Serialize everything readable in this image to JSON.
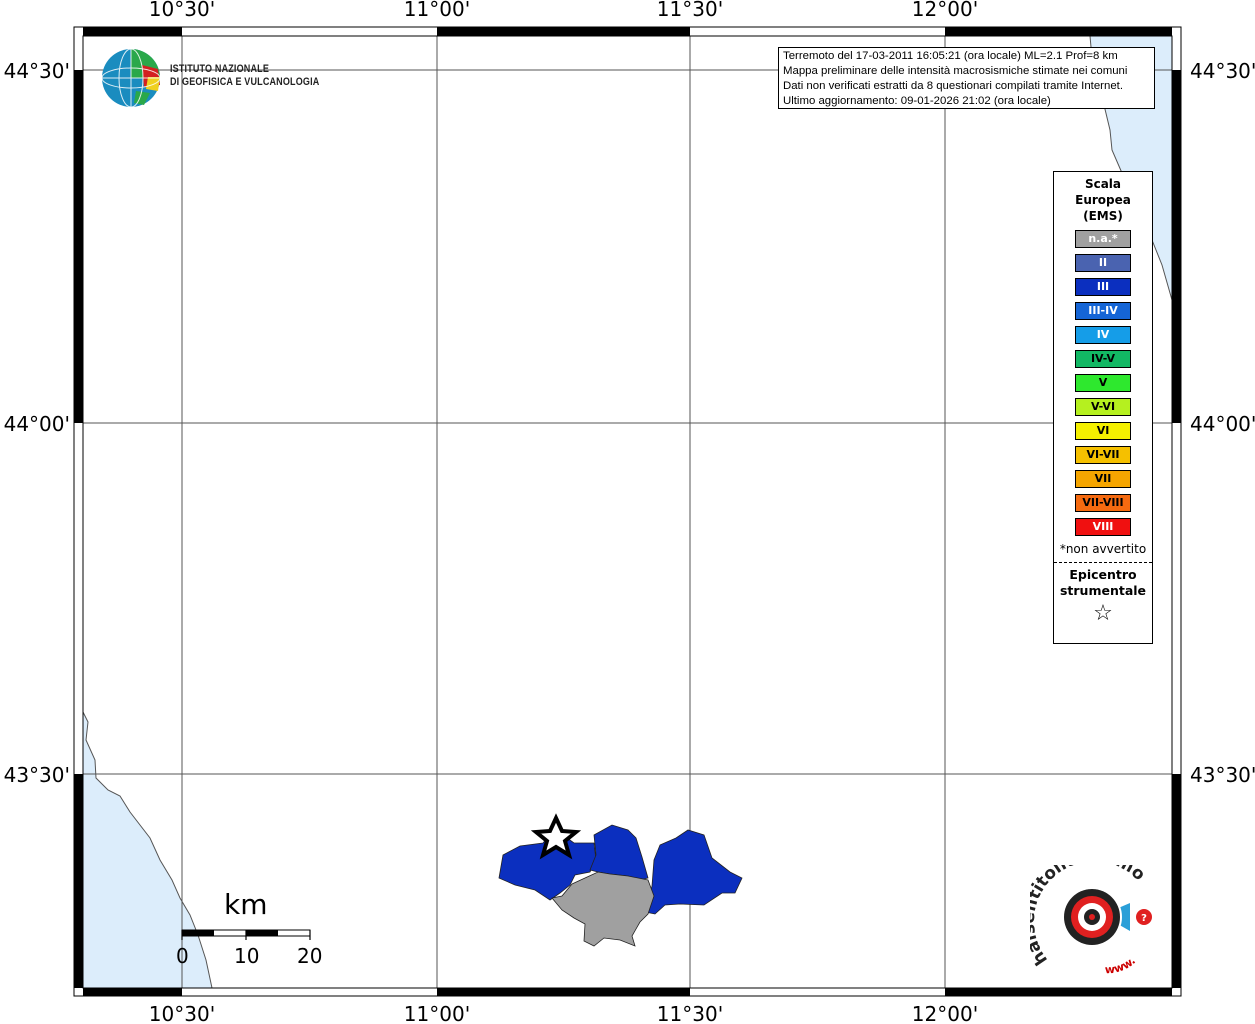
{
  "map": {
    "top_labels": [
      "10°30'",
      "11°00'",
      "11°30'",
      "12°00'"
    ],
    "bottom_labels": [
      "10°30'",
      "11°00'",
      "11°30'",
      "12°00'"
    ],
    "left_labels": [
      "44°30'",
      "44°00'",
      "43°30'"
    ],
    "right_labels": [
      "44°30'",
      "44°00'",
      "43°30'"
    ]
  },
  "info_box": {
    "line1": "Terremoto del 17-03-2011 16:05:21 (ora locale) ML=2.1 Prof=8 km",
    "line2": "Mappa preliminare delle intensità macrosismiche stimate nei comuni",
    "line3": "Dati non verificati estratti da 8 questionari compilati tramite Internet.",
    "line4": "Ultimo aggiornamento: 09-01-2026 21:02 (ora locale)"
  },
  "institute": {
    "line1": "ISTITUTO NAZIONALE",
    "line2": "DI GEOFISICA E VULCANOLOGIA"
  },
  "legend": {
    "title1": "Scala",
    "title2": "Europea",
    "title3": "(EMS)",
    "items": [
      {
        "label": "n.a.*",
        "color": "#a0a0a0",
        "text_color": "#ffffff"
      },
      {
        "label": "II",
        "color": "#4a63b0",
        "text_color": "#ffffff"
      },
      {
        "label": "III",
        "color": "#0b2fbf",
        "text_color": "#ffffff"
      },
      {
        "label": "III-IV",
        "color": "#1565d6",
        "text_color": "#ffffff"
      },
      {
        "label": "IV",
        "color": "#159de8",
        "text_color": "#ffffff"
      },
      {
        "label": "IV-V",
        "color": "#12b864",
        "text_color": "#000000"
      },
      {
        "label": "V",
        "color": "#2ee82e",
        "text_color": "#000000"
      },
      {
        "label": "V-VI",
        "color": "#b5f01f",
        "text_color": "#000000"
      },
      {
        "label": "VI",
        "color": "#f5f000",
        "text_color": "#000000"
      },
      {
        "label": "VI-VII",
        "color": "#f5c000",
        "text_color": "#000000"
      },
      {
        "label": "VII",
        "color": "#f5a500",
        "text_color": "#000000"
      },
      {
        "label": "VII-VIII",
        "color": "#f56a10",
        "text_color": "#000000"
      },
      {
        "label": "VIII",
        "color": "#f01010",
        "text_color": "#ffffff"
      }
    ],
    "note": "*non avvertito",
    "epicenter1": "Epicentro",
    "epicenter2": "strumentale",
    "epicenter_symbol": "☆"
  },
  "scalebar": {
    "title": "km",
    "labels": [
      "0",
      "10",
      "20"
    ]
  },
  "footer_logo": {
    "text": "haisentitoilterremoto.it",
    "prefix": "www."
  },
  "colors": {
    "sea": "#dcedfb",
    "intensity_iii": "#0b2fbf",
    "not_available": "#a0a0a0"
  }
}
